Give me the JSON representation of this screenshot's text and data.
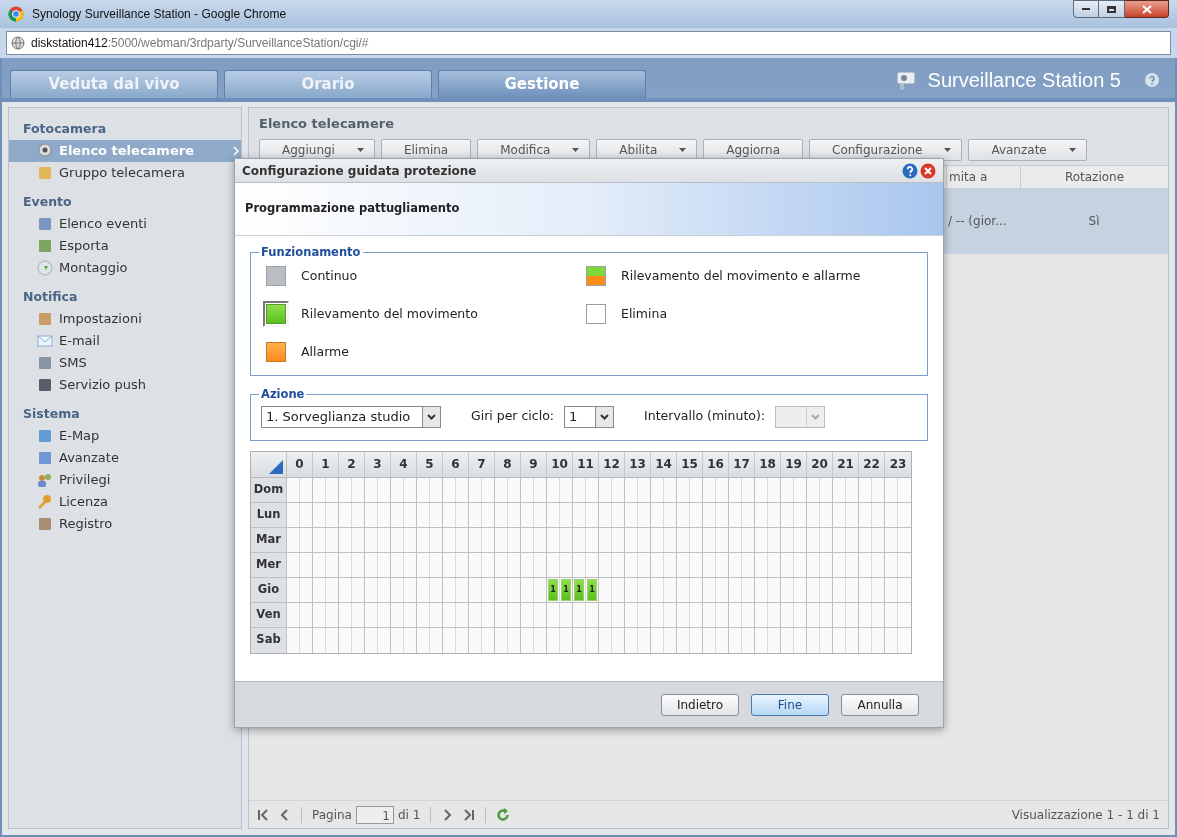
{
  "window": {
    "title": "Synology Surveillance Station - Google Chrome"
  },
  "address_bar": {
    "host": "diskstation412",
    "path": ":5000/webman/3rdparty/SurveillanceStation/cgi/#"
  },
  "tabs": [
    {
      "label": "Veduta dal vivo",
      "selected": false
    },
    {
      "label": "Orario",
      "selected": false
    },
    {
      "label": "Gestione",
      "selected": true
    }
  ],
  "brand": {
    "title": "Surveillance Station 5"
  },
  "sidebar": {
    "sections": [
      {
        "title": "Fotocamera",
        "items": [
          {
            "label": "Elenco telecamere",
            "selected": true
          },
          {
            "label": "Gruppo telecamera",
            "selected": false
          }
        ]
      },
      {
        "title": "Evento",
        "items": [
          {
            "label": "Elenco eventi",
            "selected": false
          },
          {
            "label": "Esporta",
            "selected": false
          },
          {
            "label": "Montaggio",
            "selected": false
          }
        ]
      },
      {
        "title": "Notifica",
        "items": [
          {
            "label": "Impostazioni",
            "selected": false
          },
          {
            "label": "E-mail",
            "selected": false
          },
          {
            "label": "SMS",
            "selected": false
          },
          {
            "label": "Servizio push",
            "selected": false
          }
        ]
      },
      {
        "title": "Sistema",
        "items": [
          {
            "label": "E-Map",
            "selected": false
          },
          {
            "label": "Avanzate",
            "selected": false
          },
          {
            "label": "Privilegi",
            "selected": false
          },
          {
            "label": "Licenza",
            "selected": false
          },
          {
            "label": "Registro",
            "selected": false
          }
        ]
      }
    ]
  },
  "main": {
    "title": "Elenco telecamere",
    "toolbar": [
      {
        "label": "Aggiungi",
        "has_menu": true
      },
      {
        "label": "Elimina",
        "has_menu": false
      },
      {
        "label": "Modifica",
        "has_menu": true
      },
      {
        "label": "Abilita",
        "has_menu": true
      },
      {
        "label": "Aggiorna",
        "has_menu": false
      },
      {
        "label": "Configurazione",
        "has_menu": true
      },
      {
        "label": "Avanzate",
        "has_menu": true
      }
    ],
    "table": {
      "columns": [
        "mita a",
        "Rotazione"
      ],
      "rows": [
        {
          "cells": [
            "/ -- (gior...",
            "Sì"
          ],
          "selected": true
        }
      ]
    },
    "pager": {
      "page_label": "Pagina",
      "page": "1",
      "of_label": "di 1",
      "summary": "Visualizzazione 1 - 1 di 1"
    }
  },
  "dialog": {
    "title": "Configurazione guidata protezione",
    "step": "Programmazione pattugliamento",
    "modes": {
      "title": "Funzionamento",
      "items": [
        {
          "label": "Continuo",
          "kind": "continuous",
          "selected": false
        },
        {
          "label": "Rilevamento del movimento",
          "kind": "motion",
          "selected": true
        },
        {
          "label": "Allarme",
          "kind": "alarm",
          "selected": false
        },
        {
          "label": "Rilevamento del movimento e allarme",
          "kind": "motion_alarm",
          "selected": false
        },
        {
          "label": "Elimina",
          "kind": "delete",
          "selected": false
        }
      ]
    },
    "action": {
      "title": "Azione",
      "preset": {
        "value": "1. Sorveglianza studio"
      },
      "rounds": {
        "label": "Giri per ciclo:",
        "value": "1"
      },
      "interval": {
        "label": "Intervallo (minuto):",
        "disabled": true
      }
    },
    "schedule": {
      "hours": [
        "0",
        "1",
        "2",
        "3",
        "4",
        "5",
        "6",
        "7",
        "8",
        "9",
        "10",
        "11",
        "12",
        "13",
        "14",
        "15",
        "16",
        "17",
        "18",
        "19",
        "20",
        "21",
        "22",
        "23"
      ],
      "rows": [
        {
          "day": "Dom"
        },
        {
          "day": "Lun"
        },
        {
          "day": "Mar"
        },
        {
          "day": "Mer"
        },
        {
          "day": "Gio",
          "slots": [
            {
              "kind": "empty"
            },
            {
              "kind": "empty"
            },
            {
              "kind": "empty"
            },
            {
              "kind": "empty"
            },
            {
              "kind": "empty"
            },
            {
              "kind": "empty"
            },
            {
              "kind": "empty"
            },
            {
              "kind": "empty"
            },
            {
              "kind": "empty"
            },
            {
              "kind": "empty"
            },
            {
              "kind": "empty"
            },
            {
              "kind": "empty"
            },
            {
              "kind": "empty"
            },
            {
              "kind": "empty"
            },
            {
              "kind": "empty"
            },
            {
              "kind": "empty"
            },
            {
              "kind": "empty"
            },
            {
              "kind": "empty"
            },
            {
              "kind": "empty"
            },
            {
              "kind": "empty"
            },
            {
              "label": "1",
              "kind": "motion"
            },
            {
              "label": "1",
              "kind": "motion"
            },
            {
              "label": "1",
              "kind": "motion"
            },
            {
              "label": "1",
              "kind": "motion"
            },
            {
              "kind": "empty"
            },
            {
              "kind": "empty"
            },
            {
              "kind": "empty"
            },
            {
              "kind": "empty"
            },
            {
              "kind": "empty"
            },
            {
              "kind": "empty"
            },
            {
              "kind": "empty"
            },
            {
              "kind": "empty"
            },
            {
              "kind": "empty"
            },
            {
              "kind": "empty"
            },
            {
              "kind": "empty"
            },
            {
              "kind": "empty"
            },
            {
              "kind": "empty"
            },
            {
              "kind": "empty"
            },
            {
              "kind": "empty"
            },
            {
              "kind": "empty"
            },
            {
              "kind": "empty"
            },
            {
              "kind": "empty"
            },
            {
              "kind": "empty"
            },
            {
              "kind": "empty"
            },
            {
              "kind": "empty"
            },
            {
              "kind": "empty"
            },
            {
              "kind": "empty"
            },
            {
              "kind": "empty"
            }
          ]
        },
        {
          "day": "Ven"
        },
        {
          "day": "Sab"
        }
      ]
    },
    "buttons": [
      {
        "label": "Indietro",
        "primary": false
      },
      {
        "label": "Fine",
        "primary": true
      },
      {
        "label": "Annulla",
        "primary": false
      }
    ]
  }
}
